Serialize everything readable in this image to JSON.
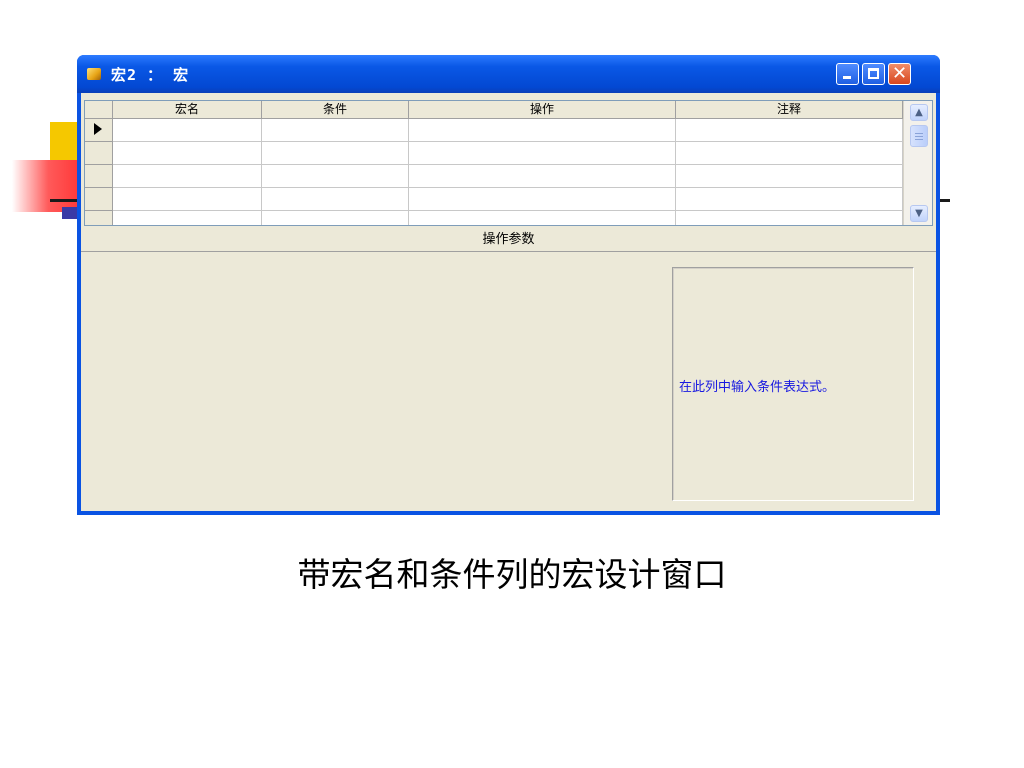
{
  "window": {
    "title": "宏2 ： 宏"
  },
  "grid": {
    "columns": [
      "宏名",
      "条件",
      "操作",
      "注释"
    ],
    "rows": [
      {
        "macro_name": "",
        "condition": "",
        "action": "",
        "comment": ""
      },
      {
        "macro_name": "",
        "condition": "",
        "action": "",
        "comment": ""
      },
      {
        "macro_name": "",
        "condition": "",
        "action": "",
        "comment": ""
      },
      {
        "macro_name": "",
        "condition": "",
        "action": "",
        "comment": ""
      }
    ]
  },
  "action_arguments": {
    "header": "操作参数",
    "help_text": "在此列中输入条件表达式。"
  },
  "caption": "带宏名和条件列的宏设计窗口",
  "colors": {
    "title_bar": "#0a58e6",
    "window_bg": "#ece9d8",
    "help_text": "#1818e0",
    "close_button": "#d8461e"
  }
}
